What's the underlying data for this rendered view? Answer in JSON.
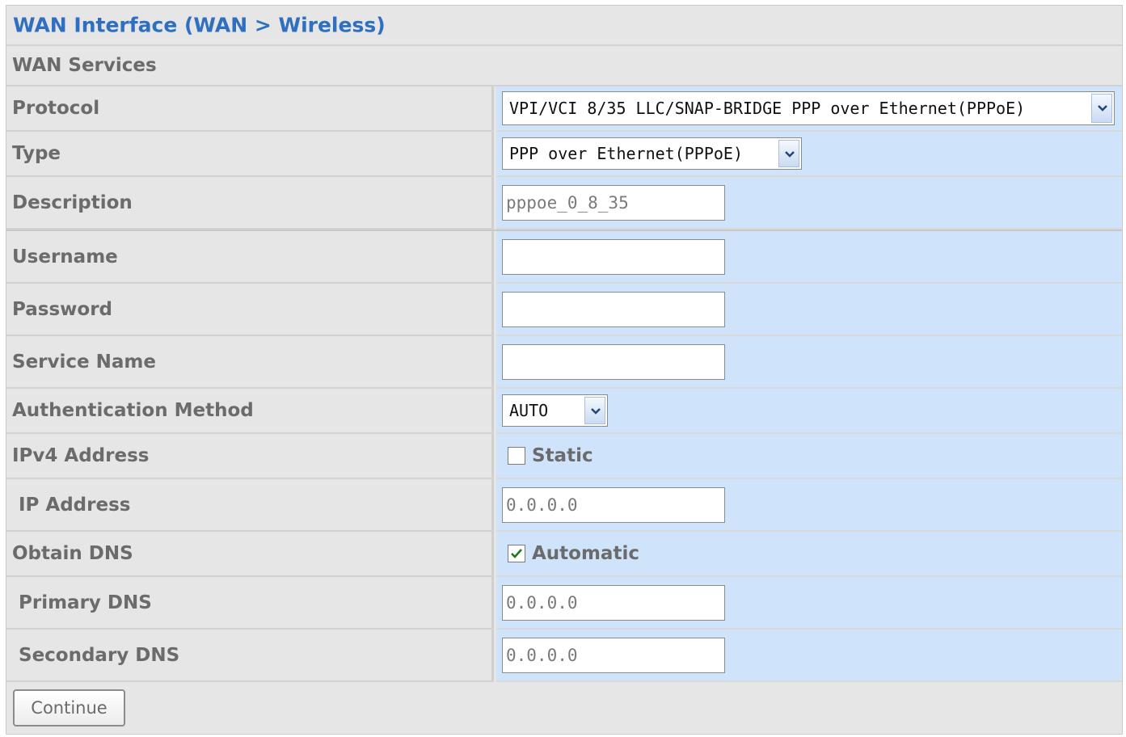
{
  "title": "WAN Interface (WAN > Wireless)",
  "section": "WAN Services",
  "protocol": {
    "label": "Protocol",
    "value": "VPI/VCI 8/35 LLC/SNAP-BRIDGE PPP over Ethernet(PPPoE)"
  },
  "type": {
    "label": "Type",
    "value": "PPP over Ethernet(PPPoE)"
  },
  "description": {
    "label": "Description",
    "value": "pppoe_0_8_35"
  },
  "username": {
    "label": "Username",
    "value": ""
  },
  "password": {
    "label": "Password",
    "value": ""
  },
  "service_name": {
    "label": "Service Name",
    "value": ""
  },
  "auth_method": {
    "label": "Authentication Method",
    "value": "AUTO"
  },
  "ipv4_address": {
    "label": "IPv4 Address",
    "checkbox_label": "Static",
    "checked": false
  },
  "ip_address": {
    "label": "IP Address",
    "value": "0.0.0.0"
  },
  "obtain_dns": {
    "label": "Obtain DNS",
    "checkbox_label": "Automatic",
    "checked": true
  },
  "primary_dns": {
    "label": "Primary DNS",
    "value": "0.0.0.0"
  },
  "secondary_dns": {
    "label": "Secondary DNS",
    "value": "0.0.0.0"
  },
  "continue_label": "Continue",
  "colors": {
    "title": "#2f6fc0",
    "value_cell": "#cfe3fb",
    "label_cell": "#e6e6e6"
  },
  "icons": {
    "dropdown": "chevron-down-icon",
    "check": "check-icon"
  }
}
